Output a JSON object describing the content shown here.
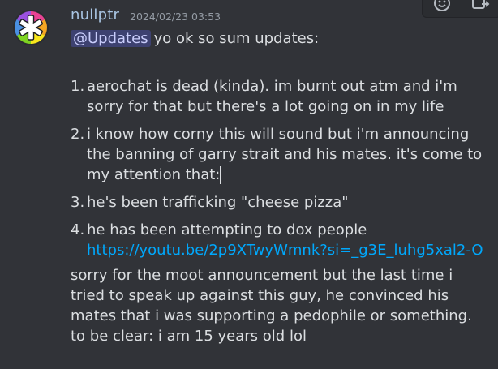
{
  "message": {
    "username": "nullptr",
    "timestamp": "2024/02/23 03:53",
    "mention": "@Updates",
    "intro": "yo ok so sum updates:",
    "items": [
      {
        "num": "1.",
        "text": "aerochat is dead (kinda). im burnt out atm and i'm sorry for that but there's a lot going on in my life"
      },
      {
        "num": "2.",
        "text": "i know how corny this will sound but i'm announcing the banning of garry strait and his mates. it's come to my attention that:"
      },
      {
        "num": "3.",
        "text": "he's been trafficking \"cheese pizza\""
      },
      {
        "num": "4.",
        "text": "he has been attempting to dox people ",
        "link": "https://youtu.be/2p9XTwyWmnk?si=_g3E_luhg5xal2-O"
      }
    ],
    "footer": "sorry for the moot announcement but the last time i tried to speak up against this guy, he convinced his mates that i was supporting a pedophile or something. to be clear: i am 15 years old lol"
  },
  "toolbar": {
    "icons": [
      "add-reaction-icon",
      "forward-icon"
    ]
  },
  "colors": {
    "background": "#313338",
    "username": "#a9c5e3",
    "link": "#00a8fc",
    "mention_bg": "#5865f24d"
  }
}
